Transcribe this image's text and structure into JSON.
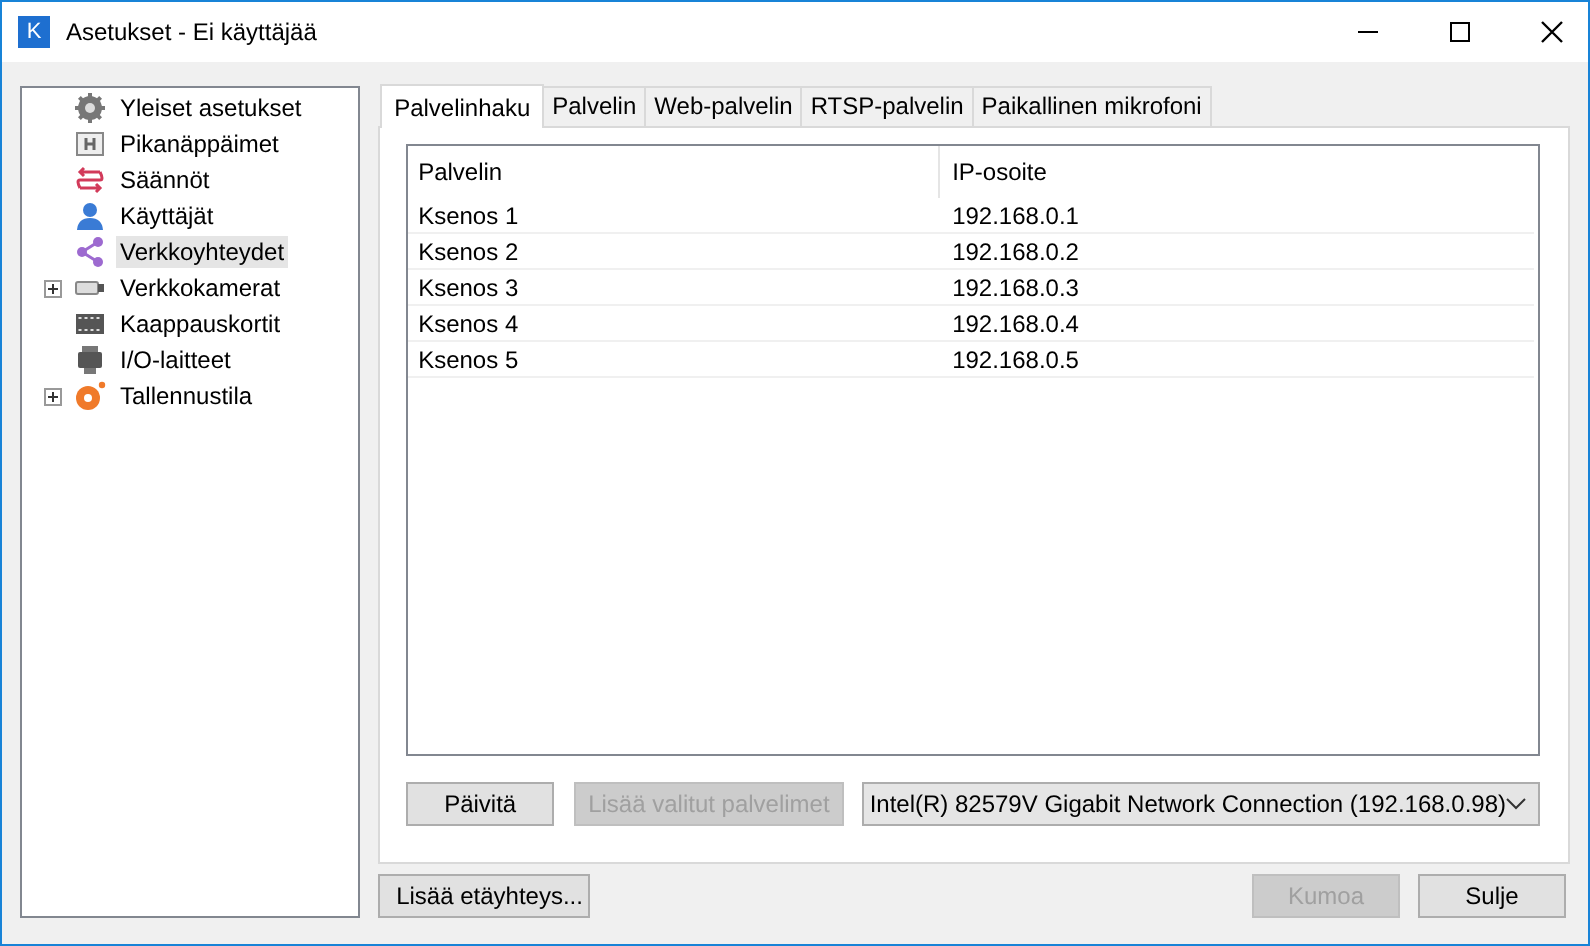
{
  "window": {
    "title": "Asetukset - Ei käyttäjää",
    "logo": "K"
  },
  "sidebar": {
    "items": [
      {
        "label": "Yleiset asetukset",
        "selected": false,
        "expandable": false
      },
      {
        "label": "Pikanäppäimet",
        "selected": false,
        "expandable": false
      },
      {
        "label": "Säännöt",
        "selected": false,
        "expandable": false
      },
      {
        "label": "Käyttäjät",
        "selected": false,
        "expandable": false
      },
      {
        "label": "Verkkoyhteydet",
        "selected": true,
        "expandable": false
      },
      {
        "label": "Verkkokamerat",
        "selected": false,
        "expandable": true
      },
      {
        "label": "Kaappauskortit",
        "selected": false,
        "expandable": false
      },
      {
        "label": "I/O-laitteet",
        "selected": false,
        "expandable": false
      },
      {
        "label": "Tallennustila",
        "selected": false,
        "expandable": true
      }
    ]
  },
  "tabs": [
    {
      "label": "Palvelinhaku",
      "selected": true
    },
    {
      "label": "Palvelin",
      "selected": false
    },
    {
      "label": "Web-palvelin",
      "selected": false
    },
    {
      "label": "RTSP-palvelin",
      "selected": false
    },
    {
      "label": "Paikallinen mikrofoni",
      "selected": false
    }
  ],
  "table": {
    "columns": [
      "Palvelin",
      "IP-osoite"
    ],
    "rows": [
      [
        "Ksenos 1",
        "192.168.0.1"
      ],
      [
        "Ksenos 2",
        "192.168.0.2"
      ],
      [
        "Ksenos 3",
        "192.168.0.3"
      ],
      [
        "Ksenos 4",
        "192.168.0.4"
      ],
      [
        "Ksenos 5",
        "192.168.0.5"
      ]
    ]
  },
  "panel_buttons": [
    {
      "label": "Päivitä",
      "disabled": false
    },
    {
      "label": "Lisää valitut palvelimet",
      "disabled": true
    }
  ],
  "network_select": {
    "value": "Intel(R) 82579V Gigabit Network Connection (192.168.0.98)"
  },
  "footer": {
    "left_button": {
      "label": "Lisää etäyhteys...",
      "disabled": false
    },
    "buttons": [
      {
        "label": "Kumoa",
        "disabled": true
      },
      {
        "label": "Sulje",
        "disabled": false
      }
    ]
  }
}
